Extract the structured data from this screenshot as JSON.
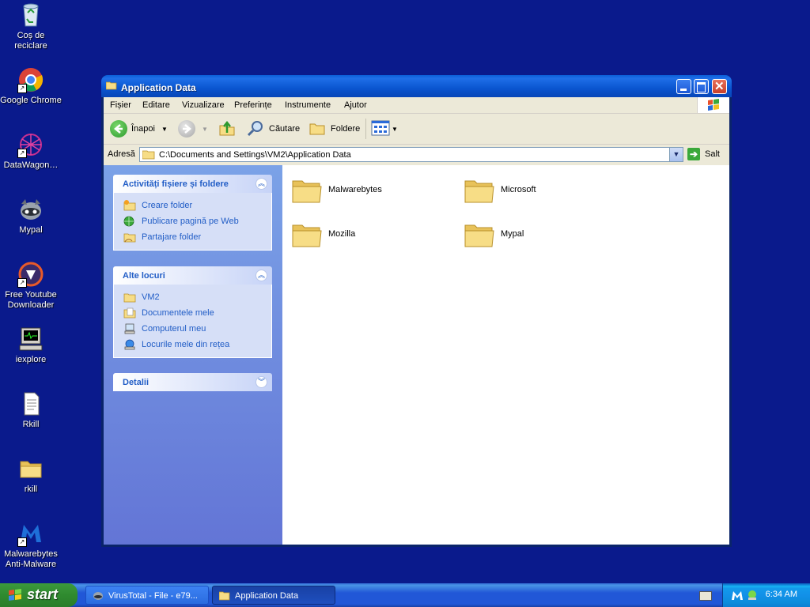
{
  "desktop": {
    "icons": [
      {
        "label": "Coș de reciclare",
        "icon": "recycle-bin-icon"
      },
      {
        "label": "Google Chrome",
        "icon": "chrome-icon"
      },
      {
        "label": "DataWagon…",
        "icon": "datawagon-icon"
      },
      {
        "label": "Mypal",
        "icon": "mypal-icon"
      },
      {
        "label": "Free Youtube Downloader",
        "icon": "youtube-downloader-icon"
      },
      {
        "label": "iexplore",
        "icon": "computer-icon"
      },
      {
        "label": "Rkill",
        "icon": "text-file-icon"
      },
      {
        "label": "rkill",
        "icon": "folder-icon"
      },
      {
        "label": "Malwarebytes Anti-Malware",
        "icon": "malwarebytes-icon"
      }
    ]
  },
  "window": {
    "title": "Application Data",
    "menu": [
      "Fișier",
      "Editare",
      "Vizualizare",
      "Preferințe",
      "Instrumente",
      "Ajutor"
    ],
    "toolbar": {
      "back_label": "Înapoi",
      "search_label": "Căutare",
      "folders_label": "Foldere"
    },
    "address": {
      "label": "Adresă",
      "value": "C:\\Documents and Settings\\VM2\\Application Data",
      "go_label": "Salt"
    },
    "taskpane": {
      "file_tasks": {
        "title": "Activități fișiere și foldere",
        "items": [
          "Creare folder",
          "Publicare pagină pe Web",
          "Partajare folder"
        ]
      },
      "other_places": {
        "title": "Alte locuri",
        "items": [
          "VM2",
          "Documentele mele",
          "Computerul meu",
          "Locurile mele din rețea"
        ]
      },
      "details": {
        "title": "Detalii"
      }
    },
    "files": [
      "Malwarebytes",
      "Microsoft",
      "Mozilla",
      "Mypal"
    ]
  },
  "taskbar": {
    "start_label": "start",
    "tasks": [
      {
        "label": "VirusTotal - File - e79...",
        "active": false
      },
      {
        "label": "Application Data",
        "active": true
      }
    ],
    "clock": "6:34 AM"
  },
  "colors": {
    "desktop": "#0a1a8c",
    "titlebar": "#0a55cf",
    "taskpane_link": "#215dc6",
    "start_green": "#2f8a2f"
  }
}
